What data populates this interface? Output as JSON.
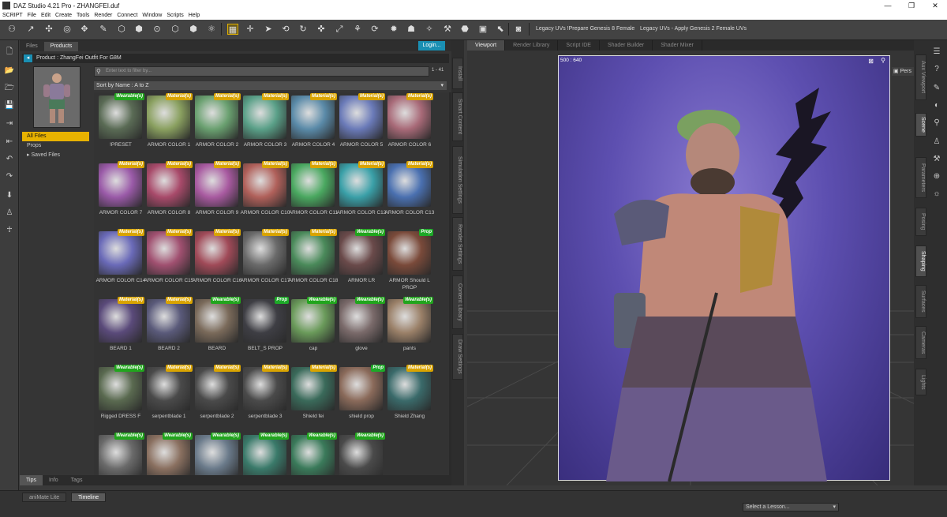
{
  "window": {
    "title": "DAZ Studio 4.21 Pro - ZHANGFEI.duf",
    "minimize": "—",
    "maximize": "❐",
    "close": "✕"
  },
  "menu": [
    "SCRIPT",
    "File",
    "Edit",
    "Create",
    "Tools",
    "Render",
    "Connect",
    "Window",
    "Scripts",
    "Help"
  ],
  "toolbar": {
    "legacy_prepare": "Legacy UVs !Prepare Genesis 8 Female",
    "legacy_apply": "Legacy UVs - Apply Genesis 2 Female UVs"
  },
  "content": {
    "tabs": [
      "Files",
      "Products"
    ],
    "login_label": "Login...",
    "product_title": "Product :  ZhangFei Outfit For G8M",
    "folders": [
      "All Files",
      "Props",
      "Saved Files"
    ],
    "search_placeholder": "Enter text to filter by...",
    "count": "1 - 41",
    "sort": "Sort by Name : A to Z",
    "bottom_tabs": [
      "Tips",
      "Info",
      "Tags"
    ],
    "side_tabs": [
      "Install",
      "Smart Content",
      "Simulation Settings",
      "Render Settings",
      "Content Library",
      "Draw Settings"
    ],
    "items": [
      {
        "label": "!PRESET",
        "badge": "Wearable(s)",
        "kind": "wearable",
        "color": "#5a6b55"
      },
      {
        "label": "ARMOR COLOR 1",
        "badge": "Material(s)",
        "kind": "material",
        "color": "#8aa060"
      },
      {
        "label": "ARMOR COLOR 2",
        "badge": "Material(s)",
        "kind": "material",
        "color": "#6aa070"
      },
      {
        "label": "ARMOR COLOR 3",
        "badge": "Material(s)",
        "kind": "material",
        "color": "#5aa088"
      },
      {
        "label": "ARMOR COLOR 4",
        "badge": "Material(s)",
        "kind": "material",
        "color": "#5a8aa8"
      },
      {
        "label": "ARMOR COLOR 5",
        "badge": "Material(s)",
        "kind": "material",
        "color": "#6a7ab8"
      },
      {
        "label": "ARMOR COLOR 6",
        "badge": "Material(s)",
        "kind": "material",
        "color": "#a86a78"
      },
      {
        "label": "ARMOR COLOR 7",
        "badge": "Material(s)",
        "kind": "material",
        "color": "#9a5aa8"
      },
      {
        "label": "ARMOR COLOR 8",
        "badge": "Material(s)",
        "kind": "material",
        "color": "#a84a6a"
      },
      {
        "label": "ARMOR COLOR 9",
        "badge": "Material(s)",
        "kind": "material",
        "color": "#a85aa0"
      },
      {
        "label": "ARMOR COLOR C10",
        "badge": "Material(s)",
        "kind": "material",
        "color": "#b0605a"
      },
      {
        "label": "ARMOR COLOR C11",
        "badge": "Material(s)",
        "kind": "material",
        "color": "#4aa860"
      },
      {
        "label": "ARMOR COLOR C12",
        "badge": "Material(s)",
        "kind": "material",
        "color": "#3aa0a8"
      },
      {
        "label": "ARMOR COLOR C13",
        "badge": "Material(s)",
        "kind": "material",
        "color": "#4a70b0"
      },
      {
        "label": "ARMOR COLOR C14",
        "badge": "Material(s)",
        "kind": "material",
        "color": "#6a6ab8"
      },
      {
        "label": "ARMOR COLOR C15",
        "badge": "Material(s)",
        "kind": "material",
        "color": "#a05070"
      },
      {
        "label": "ARMOR COLOR C16",
        "badge": "Material(s)",
        "kind": "material",
        "color": "#a04a58"
      },
      {
        "label": "ARMOR COLOR C17",
        "badge": "Material(s)",
        "kind": "material",
        "color": "#6a6a6a"
      },
      {
        "label": "ARMOR COLOR C18",
        "badge": "Material(s)",
        "kind": "material",
        "color": "#4a8a5a"
      },
      {
        "label": "ARMOR LR",
        "badge": "Wearable(s)",
        "kind": "wearable",
        "color": "#6a4a4a"
      },
      {
        "label": "ARMOR Should L PROP",
        "badge": "Prop",
        "kind": "prop",
        "color": "#7a4a3a"
      },
      {
        "label": "BEARD 1",
        "badge": "Material(s)",
        "kind": "material",
        "color": "#5a4a7a"
      },
      {
        "label": "BEARD 2",
        "badge": "Material(s)",
        "kind": "material",
        "color": "#5a5a7a"
      },
      {
        "label": "BEARD",
        "badge": "Wearable(s)",
        "kind": "wearable",
        "color": "#7a6a5a"
      },
      {
        "label": "BELT_S PROP",
        "badge": "Prop",
        "kind": "prop",
        "color": "#3e3e44"
      },
      {
        "label": "cap",
        "badge": "Wearable(s)",
        "kind": "wearable",
        "color": "#6a9a5a"
      },
      {
        "label": "glove",
        "badge": "Wearable(s)",
        "kind": "wearable",
        "color": "#7a6a6a"
      },
      {
        "label": "pants",
        "badge": "Wearable(s)",
        "kind": "wearable",
        "color": "#9a8068"
      },
      {
        "label": "Rigged DRESS F",
        "badge": "Wearable(s)",
        "kind": "wearable",
        "color": "#5a6a50"
      },
      {
        "label": "serpentblade 1",
        "badge": "Material(s)",
        "kind": "material",
        "color": "#4a4a4a"
      },
      {
        "label": "serpentblade 2",
        "badge": "Material(s)",
        "kind": "material",
        "color": "#4a4a4a"
      },
      {
        "label": "serpentblade 3",
        "badge": "Material(s)",
        "kind": "material",
        "color": "#4a4a4a"
      },
      {
        "label": "Shield fei",
        "badge": "Material(s)",
        "kind": "material",
        "color": "#3a6a5a"
      },
      {
        "label": "shield prop",
        "badge": "Prop",
        "kind": "prop",
        "color": "#8a6a5a"
      },
      {
        "label": "Shield Zhang",
        "badge": "Material(s)",
        "kind": "material",
        "color": "#3a6a6a"
      },
      {
        "label": "",
        "badge": "Wearable(s)",
        "kind": "wearable",
        "color": "#6a6a6a"
      },
      {
        "label": "",
        "badge": "Wearable(s)",
        "kind": "wearable",
        "color": "#8a7060"
      },
      {
        "label": "",
        "badge": "Wearable(s)",
        "kind": "wearable",
        "color": "#6a7a8a"
      },
      {
        "label": "",
        "badge": "Wearable(s)",
        "kind": "wearable",
        "color": "#3a7a6a"
      },
      {
        "label": "",
        "badge": "Wearable(s)",
        "kind": "wearable",
        "color": "#3a7a5a"
      },
      {
        "label": "",
        "badge": "Wearable(s)",
        "kind": "wearable",
        "color": "#4a4a4a"
      }
    ]
  },
  "viewport": {
    "tabs": [
      "Viewport",
      "Render Library",
      "Script IDE",
      "Shader Builder",
      "Shader Mixer"
    ],
    "dims": "500 : 640",
    "perspective": "Pers"
  },
  "right_tabs": [
    "Aux Viewport",
    "Scene",
    "Parameters",
    "Posing",
    "Shaping",
    "Surfaces",
    "Cameras",
    "Lights"
  ],
  "status": {
    "tabs": [
      "aniMate Lite",
      "Timeline"
    ],
    "lesson": "Select a Lesson..."
  }
}
